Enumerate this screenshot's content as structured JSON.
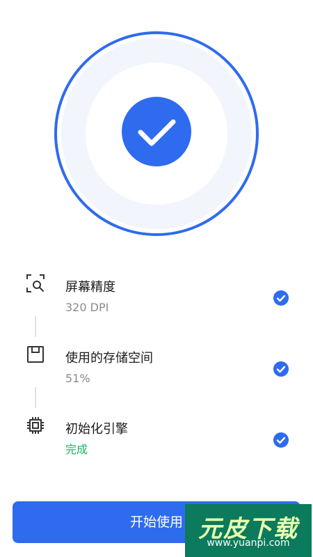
{
  "colors": {
    "primary": "#2f6bef",
    "success_text": "#19b364",
    "title_text": "#1b1b1b",
    "secondary_text": "#8a8a8a",
    "ring_fill": "#f2f5fc"
  },
  "hero": {
    "icon": "checkmark-icon"
  },
  "checks": [
    {
      "icon": "screen-scan-icon",
      "title": "屏幕精度",
      "value": "320 DPI",
      "status_icon": "check-circle-icon"
    },
    {
      "icon": "storage-icon",
      "title": "使用的存储空间",
      "value": "51%",
      "status_icon": "check-circle-icon"
    },
    {
      "icon": "chip-icon",
      "title": "初始化引擎",
      "value": "完成",
      "status_icon": "check-circle-icon"
    }
  ],
  "start_button": {
    "label": "开始使用"
  },
  "watermark": {
    "main": "元皮下载",
    "sub": "www.yuanpi.com"
  }
}
